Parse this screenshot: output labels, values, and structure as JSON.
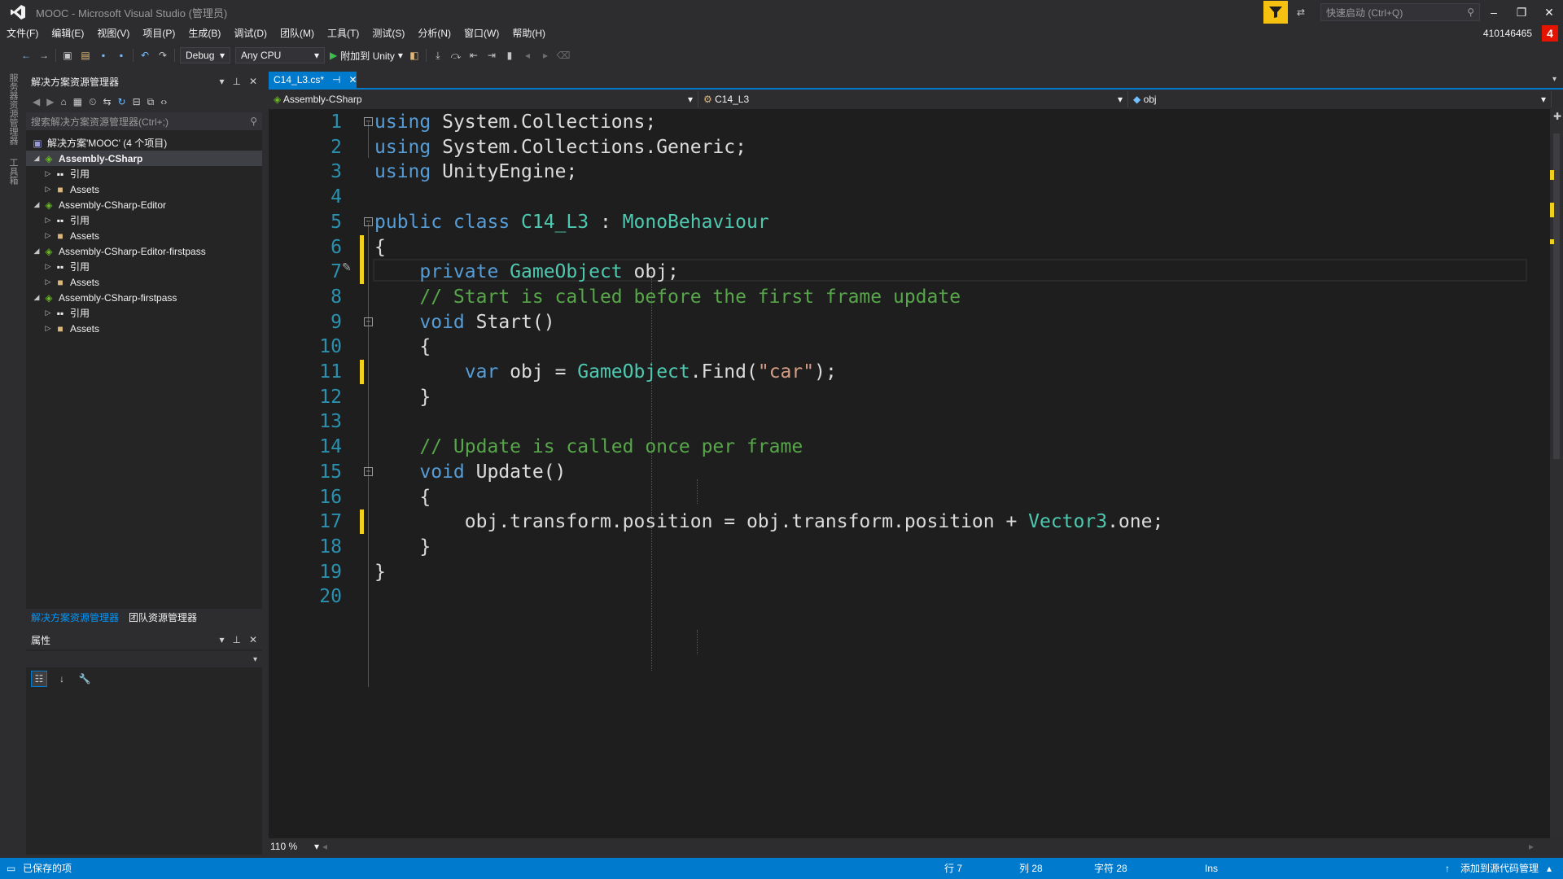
{
  "window": {
    "title": "MOOC - Microsoft Visual Studio (管理员)",
    "quick_launch_placeholder": "快速启动 (Ctrl+Q)",
    "account": "410146465",
    "notifications": "4"
  },
  "menu": [
    "文件(F)",
    "编辑(E)",
    "视图(V)",
    "项目(P)",
    "生成(B)",
    "调试(D)",
    "团队(M)",
    "工具(T)",
    "测试(S)",
    "分析(N)",
    "窗口(W)",
    "帮助(H)"
  ],
  "toolbar": {
    "config": "Debug",
    "platform": "Any CPU",
    "attach_label": "附加到 Unity"
  },
  "left_strip": {
    "labels": [
      "服务器资源管理器",
      "工具箱"
    ]
  },
  "solution_explorer": {
    "title": "解决方案资源管理器",
    "search_placeholder": "搜索解决方案资源管理器(Ctrl+;)",
    "root": "解决方案'MOOC' (4 个项目)",
    "projects": [
      {
        "name": "Assembly-CSharp",
        "ref": "引用",
        "assets": "Assets"
      },
      {
        "name": "Assembly-CSharp-Editor",
        "ref": "引用",
        "assets": "Assets"
      },
      {
        "name": "Assembly-CSharp-Editor-firstpass",
        "ref": "引用",
        "assets": "Assets"
      },
      {
        "name": "Assembly-CSharp-firstpass",
        "ref": "引用",
        "assets": "Assets"
      }
    ],
    "tabs": [
      "解决方案资源管理器",
      "团队资源管理器"
    ]
  },
  "properties": {
    "title": "属性"
  },
  "editor": {
    "tab_label": "C14_L3.cs*",
    "nav": {
      "project": "Assembly-CSharp",
      "class": "C14_L3",
      "member": "obj"
    },
    "zoom": "110 %",
    "lines": [
      {
        "n": "1",
        "parts": [
          [
            "k",
            "using"
          ],
          [
            "p",
            " System.Collections;"
          ]
        ]
      },
      {
        "n": "2",
        "parts": [
          [
            "k",
            "using"
          ],
          [
            "p",
            " System.Collections.Generic;"
          ]
        ]
      },
      {
        "n": "3",
        "parts": [
          [
            "k",
            "using"
          ],
          [
            "p",
            " UnityEngine;"
          ]
        ]
      },
      {
        "n": "4",
        "parts": []
      },
      {
        "n": "5",
        "parts": [
          [
            "k",
            "public class "
          ],
          [
            "t",
            "C14_L3"
          ],
          [
            "p",
            " : "
          ],
          [
            "t",
            "MonoBehaviour"
          ]
        ]
      },
      {
        "n": "6",
        "parts": [
          [
            "p",
            "{"
          ]
        ]
      },
      {
        "n": "7",
        "parts": [
          [
            "p",
            "    "
          ],
          [
            "k",
            "private "
          ],
          [
            "t",
            "GameObject"
          ],
          [
            "p",
            " obj;"
          ]
        ]
      },
      {
        "n": "8",
        "parts": [
          [
            "p",
            "    "
          ],
          [
            "c",
            "// Start is called before the first frame update"
          ]
        ]
      },
      {
        "n": "9",
        "parts": [
          [
            "p",
            "    "
          ],
          [
            "k",
            "void"
          ],
          [
            "p",
            " Start()"
          ]
        ]
      },
      {
        "n": "10",
        "parts": [
          [
            "p",
            "    {"
          ]
        ]
      },
      {
        "n": "11",
        "parts": [
          [
            "p",
            "        "
          ],
          [
            "k",
            "var"
          ],
          [
            "p",
            " obj = "
          ],
          [
            "t",
            "GameObject"
          ],
          [
            "p",
            ".Find("
          ],
          [
            "s",
            "\"car\""
          ],
          [
            "p",
            ");"
          ]
        ]
      },
      {
        "n": "12",
        "parts": [
          [
            "p",
            "    }"
          ]
        ]
      },
      {
        "n": "13",
        "parts": []
      },
      {
        "n": "14",
        "parts": [
          [
            "p",
            "    "
          ],
          [
            "c",
            "// Update is called once per frame"
          ]
        ]
      },
      {
        "n": "15",
        "parts": [
          [
            "p",
            "    "
          ],
          [
            "k",
            "void"
          ],
          [
            "p",
            " Update()"
          ]
        ]
      },
      {
        "n": "16",
        "parts": [
          [
            "p",
            "    {"
          ]
        ]
      },
      {
        "n": "17",
        "parts": [
          [
            "p",
            "        obj.transform.position = obj.transform.position + "
          ],
          [
            "t",
            "Vector3"
          ],
          [
            "p",
            ".one;"
          ]
        ]
      },
      {
        "n": "18",
        "parts": [
          [
            "p",
            "    }"
          ]
        ]
      },
      {
        "n": "19",
        "parts": [
          [
            "p",
            "}"
          ]
        ]
      },
      {
        "n": "20",
        "parts": []
      }
    ],
    "changed_lines": [
      6,
      7,
      11,
      17
    ],
    "fold_lines": [
      1,
      5,
      9,
      15
    ]
  },
  "status": {
    "left": "已保存的项",
    "row": "行 7",
    "col": "列 28",
    "char": "字符 28",
    "mode": "Ins",
    "source_control": "添加到源代码管理"
  },
  "colors": {
    "accent": "#007acc",
    "editor_bg": "#1e1e1e",
    "keyword": "#569cd6",
    "type": "#4ec9b0",
    "string": "#d69d85",
    "comment": "#57a64a",
    "line_number": "#2b91af",
    "change_marker": "#efd01c"
  }
}
